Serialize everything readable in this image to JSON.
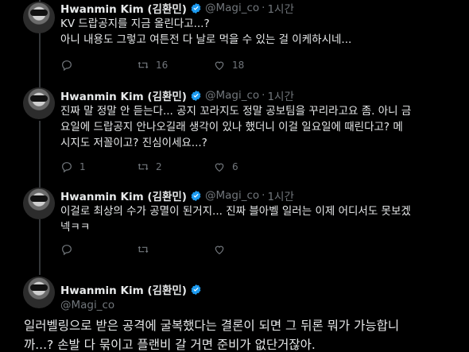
{
  "tweets": [
    {
      "name": "Hwanmin Kim (김환민)",
      "handle": "@Magi_co",
      "time": "1시간",
      "text": "KV 드랍공지를 지금 올린다고...?\n아니 내용도 그렇고 여튼전 다 날로 먹을 수 있는 걸 이케하시네...",
      "replies": "",
      "retweets": "16",
      "likes": "18"
    },
    {
      "name": "Hwanmin Kim (김환민)",
      "handle": "@Magi_co",
      "time": "1시간",
      "text": "진짜 말 정말 안 듣는다... 공지 꼬라지도 정말 공보팀을 꾸리라고요 좀. 아니 금\n요일에 드랍공지 안나오길래 생각이 있나 했더니 이걸 일요일에 때린다고? 메\n시지도 저꼴이고? 진심이세요...?",
      "replies": "1",
      "retweets": "2",
      "likes": "6"
    },
    {
      "name": "Hwanmin Kim (김환민)",
      "handle": "@Magi_co",
      "time": "1시간",
      "text": "이걸로 최상의 수가 공멸이 된거지... 진짜 블아벨 일러는 이제 어디서도 못보겠\n넥ㅋㅋ",
      "replies": "",
      "retweets": "",
      "likes": ""
    }
  ],
  "main_tweet": {
    "name": "Hwanmin Kim (김환민)",
    "handle": "@Magi_co",
    "text": "일러벨링으로 받은 공격에 굴복했다는 결론이 되면 그 뒤론 뭐가 가능합니\n까...? 손발 다 묶이고 플랜비 갈 거면 준비가 없단거잖아."
  },
  "colors": {
    "background": "#000000",
    "text": "#e7e9ea",
    "muted": "#71767b",
    "verified": "#1d9bf0"
  },
  "icons": [
    "reply-icon",
    "retweet-icon",
    "like-icon",
    "verified-icon"
  ]
}
